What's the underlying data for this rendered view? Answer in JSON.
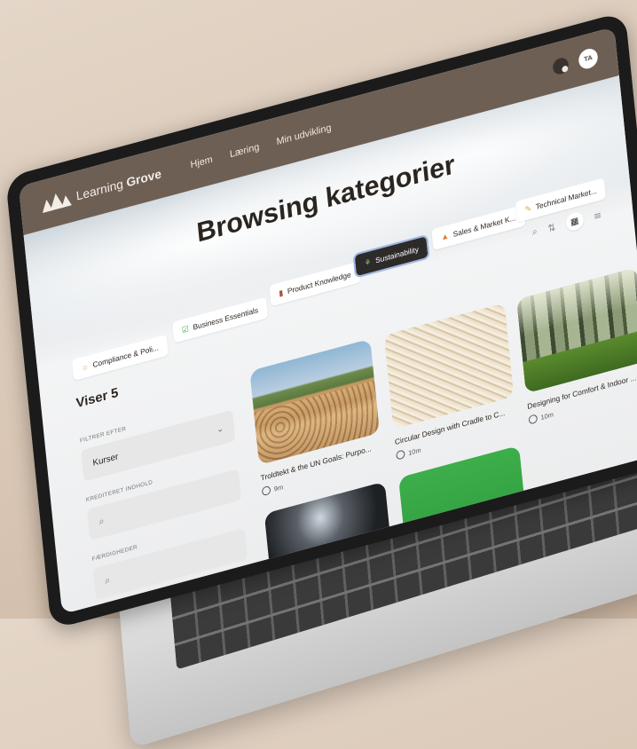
{
  "brand": {
    "name_light": "Learning",
    "name_bold": "Grove"
  },
  "nav": {
    "items": [
      "Hjem",
      "Læring",
      "Min udvikling"
    ]
  },
  "user": {
    "avatar_initials": "TA"
  },
  "page": {
    "title": "Browsing kategorier"
  },
  "categories": [
    {
      "label": "Compliance & Poli...",
      "icon": "sun-icon",
      "active": false
    },
    {
      "label": "Business Essentials",
      "icon": "check-square-icon",
      "active": false
    },
    {
      "label": "Product Knowledge",
      "icon": "jar-icon",
      "active": false
    },
    {
      "label": "Sustainability",
      "icon": "sprout-icon",
      "active": true
    },
    {
      "label": "Sales & Market K...",
      "icon": "fire-icon",
      "active": false
    },
    {
      "label": "Technical Market...",
      "icon": "pencil-icon",
      "active": false
    }
  ],
  "sidebar": {
    "showing": "Viser 5",
    "filter_label": "FILTRER EFTER",
    "filter_value": "Kurser",
    "accredited_label": "KREDITERET INDHOLD",
    "skills_label": "FÆRDIGHEDER"
  },
  "courses": [
    {
      "title": "Troldtekt & the UN Goals: Purpo...",
      "duration": "9m",
      "image": "stacked-logs-wind-turbines"
    },
    {
      "title": "Circular Design with Cradle to C...",
      "duration": "10m",
      "image": "wood-wool-fibers"
    },
    {
      "title": "Designing for Comfort & Indoor ...",
      "duration": "10m",
      "image": "sunlit-forest"
    },
    {
      "title": "",
      "duration": "",
      "image": "dark-light-burst"
    },
    {
      "title": "",
      "duration": "",
      "image": "green-banner"
    }
  ],
  "colors": {
    "topbar": "#6e5f54",
    "active_chip": "#2d2a2a",
    "active_outline": "#9fb7e0"
  }
}
